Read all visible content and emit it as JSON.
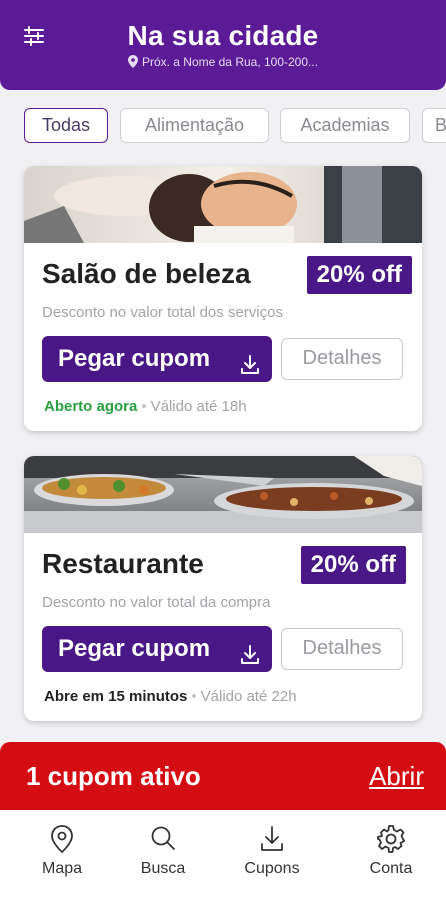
{
  "header": {
    "title": "Na sua cidade",
    "location": "Próx. a Nome da Rua, 100-200..."
  },
  "categories": [
    "Todas",
    "Alimentação",
    "Academias",
    "B"
  ],
  "offers": [
    {
      "title": "Salão de beleza",
      "discount": "20% off",
      "description": "Desconto no valor total dos serviços",
      "cta": "Pegar cupom",
      "details": "Detalhes",
      "status": "Aberto agora",
      "validity": "Válido até 18h"
    },
    {
      "title": "Restaurante",
      "discount": "20% off",
      "description": "Desconto no valor total da compra",
      "cta": "Pegar cupom",
      "details": "Detalhes",
      "status": "Abre em 15 minutos",
      "validity": "Válido até 22h"
    }
  ],
  "coupon_banner": {
    "text": "1 cupom ativo",
    "action": "Abrir"
  },
  "bottom_nav": [
    {
      "label": "Mapa",
      "icon": "map-pin-icon"
    },
    {
      "label": "Busca",
      "icon": "search-icon"
    },
    {
      "label": "Cupons",
      "icon": "download-icon"
    },
    {
      "label": "Conta",
      "icon": "gear-icon"
    }
  ],
  "colors": {
    "brand": "#5b1a96",
    "accent_dark": "#4a1787",
    "banner": "#d40d12",
    "open_status": "#2aa043"
  }
}
